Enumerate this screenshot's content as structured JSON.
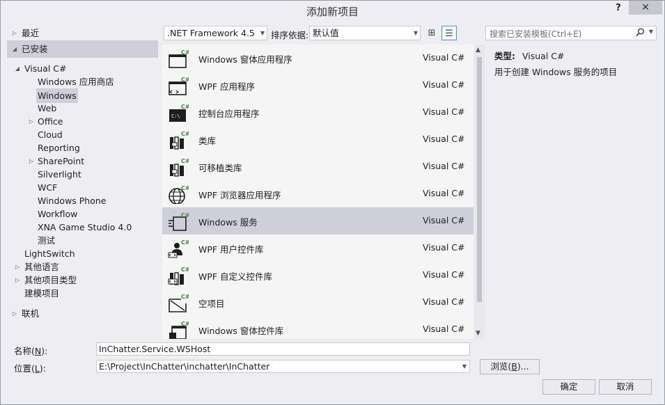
{
  "window": {
    "title": "添加新项目",
    "help": "?",
    "close": "✕"
  },
  "tree": [
    {
      "label": "最近",
      "indent": 0,
      "arrow": "▷"
    },
    {
      "label": "已安装",
      "indent": 0,
      "arrow": "◢",
      "installed": true
    },
    {
      "label": "Visual C#",
      "indent": 1,
      "arrow": "◢"
    },
    {
      "label": "Windows 应用商店",
      "indent": 2,
      "arrow": ""
    },
    {
      "label": "Windows",
      "indent": 2,
      "arrow": "",
      "selected": true
    },
    {
      "label": "Web",
      "indent": 2,
      "arrow": ""
    },
    {
      "label": "Office",
      "indent": 2,
      "arrow": "▷"
    },
    {
      "label": "Cloud",
      "indent": 2,
      "arrow": ""
    },
    {
      "label": "Reporting",
      "indent": 2,
      "arrow": ""
    },
    {
      "label": "SharePoint",
      "indent": 2,
      "arrow": "▷"
    },
    {
      "label": "Silverlight",
      "indent": 2,
      "arrow": ""
    },
    {
      "label": "WCF",
      "indent": 2,
      "arrow": ""
    },
    {
      "label": "Windows Phone",
      "indent": 2,
      "arrow": ""
    },
    {
      "label": "Workflow",
      "indent": 2,
      "arrow": ""
    },
    {
      "label": "XNA Game Studio 4.0",
      "indent": 2,
      "arrow": ""
    },
    {
      "label": "测试",
      "indent": 2,
      "arrow": ""
    },
    {
      "label": "LightSwitch",
      "indent": 1,
      "arrow": ""
    },
    {
      "label": "其他语言",
      "indent": 1,
      "arrow": "▷"
    },
    {
      "label": "其他项目类型",
      "indent": 1,
      "arrow": "▷"
    },
    {
      "label": "建模项目",
      "indent": 1,
      "arrow": ""
    },
    {
      "label": "联机",
      "indent": 0,
      "arrow": "▷"
    }
  ],
  "toolbar": {
    "framework": ".NET Framework 4.5",
    "sort_label": "排序依据:",
    "sort_value": "默认值",
    "grid_view_icon": "⊞",
    "list_view_icon": "☰"
  },
  "search": {
    "placeholder": "搜索已安装模板(Ctrl+E)",
    "icon": "⚲"
  },
  "templates": [
    {
      "name": "Windows 窗体应用程序",
      "lang": "Visual C#",
      "icon": "window"
    },
    {
      "name": "WPF 应用程序",
      "lang": "Visual C#",
      "icon": "wpf"
    },
    {
      "name": "控制台应用程序",
      "lang": "Visual C#",
      "icon": "console"
    },
    {
      "name": "类库",
      "lang": "Visual C#",
      "icon": "library"
    },
    {
      "name": "可移植类库",
      "lang": "Visual C#",
      "icon": "portable"
    },
    {
      "name": "WPF 浏览器应用程序",
      "lang": "Visual C#",
      "icon": "browser"
    },
    {
      "name": "Windows 服务",
      "lang": "Visual C#",
      "icon": "service",
      "selected": true
    },
    {
      "name": "WPF 用户控件库",
      "lang": "Visual C#",
      "icon": "usercontrol"
    },
    {
      "name": "WPF 自定义控件库",
      "lang": "Visual C#",
      "icon": "customcontrol"
    },
    {
      "name": "空项目",
      "lang": "Visual C#",
      "icon": "empty"
    },
    {
      "name": "Windows 窗体控件库",
      "lang": "Visual C#",
      "icon": "formcontrol"
    }
  ],
  "details": {
    "type_label": "类型:",
    "type_value": "Visual C#",
    "description": "用于创建 Windows 服务的项目"
  },
  "form": {
    "name_label_pre": "名称(",
    "name_key": "N",
    "name_label_post": "):",
    "name_value": "InChatter.Service.WSHost",
    "location_label_pre": "位置(",
    "location_key": "L",
    "location_label_post": "):",
    "location_value": "E:\\Project\\InChatter\\inchatter\\InChatter",
    "browse_pre": "浏览(",
    "browse_key": "B",
    "browse_post": ")...",
    "ok": "确定",
    "cancel": "取消"
  },
  "colors": {
    "selection": "#cfcfd9",
    "background": "#eeeef2",
    "accent": "#3399ff",
    "csharp_badge": "#388a34"
  }
}
